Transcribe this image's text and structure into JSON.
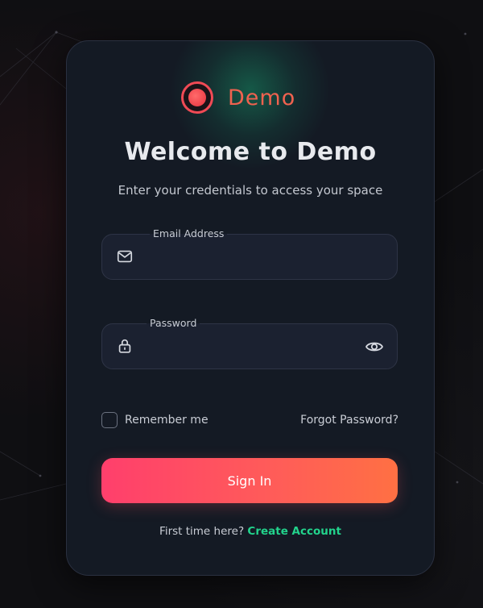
{
  "brand": {
    "name": "Demo",
    "accent_color": "#f0624f"
  },
  "header": {
    "title": "Welcome to Demo",
    "subtitle": "Enter your credentials to access your space"
  },
  "form": {
    "email": {
      "label": "Email Address",
      "value": "",
      "icon": "mail-icon"
    },
    "password": {
      "label": "Password",
      "value": "",
      "icon": "lock-icon",
      "toggle_icon": "eye-icon"
    },
    "remember_me": {
      "label": "Remember me",
      "checked": false
    },
    "forgot_password": "Forgot Password?",
    "submit_label": "Sign In",
    "submit_colors": [
      "#ff3f6c",
      "#ff7043"
    ]
  },
  "footer": {
    "prompt": "First time here?",
    "link_label": "Create Account",
    "link_color": "#22d38c"
  }
}
